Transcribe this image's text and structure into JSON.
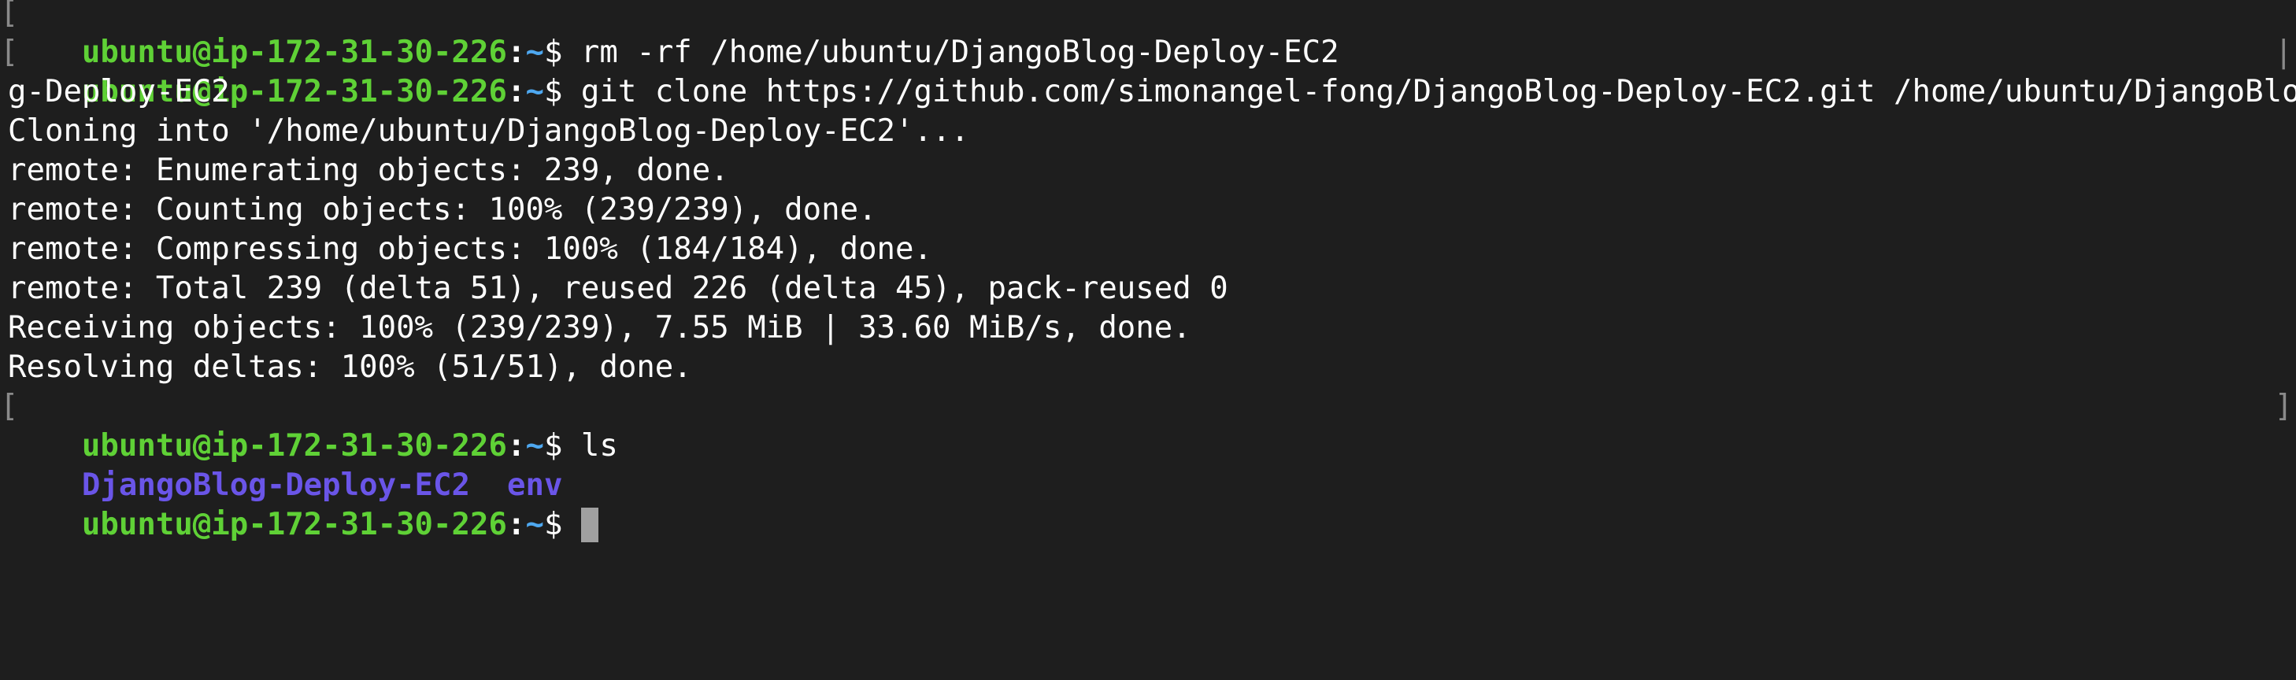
{
  "terminal": {
    "prompt": {
      "user_host": "ubuntu@ip-172-31-30-226",
      "separator": ":",
      "path": "~",
      "symbol": "$ "
    },
    "lines": [
      {
        "type": "command",
        "command": "rm -rf /home/ubuntu/DjangoBlog-Deploy-EC2"
      },
      {
        "type": "command",
        "command": "git clone https://github.com/simonangel-fong/DjangoBlog-Deploy-EC2.git /home/ubuntu/DjangoBlo"
      },
      {
        "type": "output",
        "text": "g-Deploy-EC2"
      },
      {
        "type": "output",
        "text": "Cloning into '/home/ubuntu/DjangoBlog-Deploy-EC2'..."
      },
      {
        "type": "output",
        "text": "remote: Enumerating objects: 239, done."
      },
      {
        "type": "output",
        "text": "remote: Counting objects: 100% (239/239), done."
      },
      {
        "type": "output",
        "text": "remote: Compressing objects: 100% (184/184), done."
      },
      {
        "type": "output",
        "text": "remote: Total 239 (delta 51), reused 226 (delta 45), pack-reused 0"
      },
      {
        "type": "output",
        "text": "Receiving objects: 100% (239/239), 7.55 MiB | 33.60 MiB/s, done."
      },
      {
        "type": "output",
        "text": "Resolving deltas: 100% (51/51), done."
      },
      {
        "type": "command",
        "command": "ls"
      },
      {
        "type": "listing",
        "entries": [
          "DjangoBlog-Deploy-EC2",
          "env"
        ]
      },
      {
        "type": "current_prompt"
      }
    ],
    "colors": {
      "background": "#1e1e1e",
      "user_host": "#5fd136",
      "path": "#4ea8f0",
      "directory": "#6a55e8",
      "text": "#ffffff",
      "cursor": "#a0a0a0"
    }
  }
}
